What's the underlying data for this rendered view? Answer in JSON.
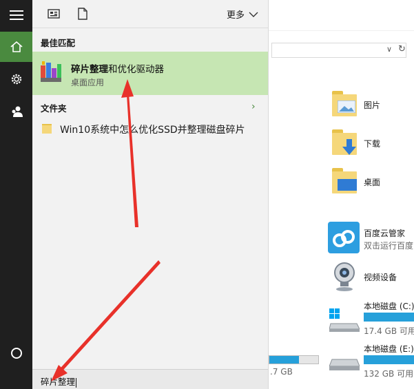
{
  "explorer": {
    "folders": [
      {
        "label": "图片"
      },
      {
        "label": "下载"
      },
      {
        "label": "桌面"
      }
    ],
    "apps": [
      {
        "title": "百度云管家",
        "subtitle": "双击运行百度"
      },
      {
        "title": "视频设备"
      }
    ],
    "drives": [
      {
        "title": "本地磁盘 (C:)",
        "free": "17.4 GB 可用"
      },
      {
        "title": "本地磁盘 (E:)",
        "free": "132 GB 可用"
      }
    ],
    "partial_drive_free": ".7 GB"
  },
  "start": {
    "more_label": "更多",
    "best_match_title": "最佳匹配",
    "best_match": {
      "name_bold": "碎片整理",
      "name_rest": "和优化驱动器",
      "type": "桌面应用"
    },
    "folders_title": "文件夹",
    "folder_result": "Win10系统中怎么优化SSD并整理磁盘碎片",
    "search_query": "碎片整理"
  },
  "colors": {
    "accent_green": "#4a8a3f",
    "highlight": "#c6e6b3",
    "drive_bar": "#26a0da",
    "arrow": "#e8312a"
  }
}
